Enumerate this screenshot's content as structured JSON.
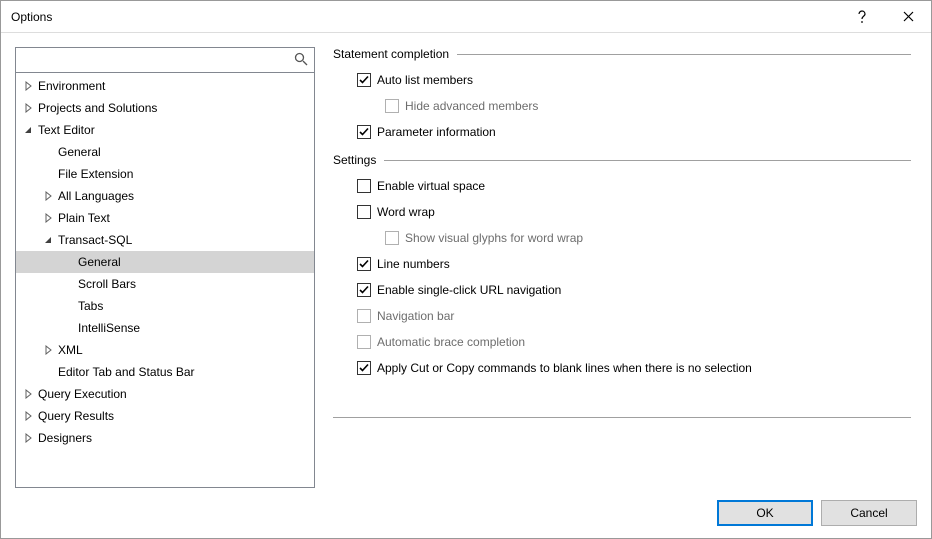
{
  "window": {
    "title": "Options"
  },
  "search": {
    "placeholder": ""
  },
  "tree": [
    {
      "label": "Environment",
      "indent": 1,
      "twisty": "closed"
    },
    {
      "label": "Projects and Solutions",
      "indent": 1,
      "twisty": "closed"
    },
    {
      "label": "Text Editor",
      "indent": 1,
      "twisty": "open"
    },
    {
      "label": "General",
      "indent": 2,
      "twisty": "none"
    },
    {
      "label": "File Extension",
      "indent": 2,
      "twisty": "none"
    },
    {
      "label": "All Languages",
      "indent": 2,
      "twisty": "closed"
    },
    {
      "label": "Plain Text",
      "indent": 2,
      "twisty": "closed"
    },
    {
      "label": "Transact-SQL",
      "indent": 2,
      "twisty": "open"
    },
    {
      "label": "General",
      "indent": 3,
      "twisty": "none",
      "selected": true
    },
    {
      "label": "Scroll Bars",
      "indent": 3,
      "twisty": "none"
    },
    {
      "label": "Tabs",
      "indent": 3,
      "twisty": "none"
    },
    {
      "label": "IntelliSense",
      "indent": 3,
      "twisty": "none"
    },
    {
      "label": "XML",
      "indent": 2,
      "twisty": "closed"
    },
    {
      "label": "Editor Tab and Status Bar",
      "indent": 2,
      "twisty": "none"
    },
    {
      "label": "Query Execution",
      "indent": 1,
      "twisty": "closed"
    },
    {
      "label": "Query Results",
      "indent": 1,
      "twisty": "closed"
    },
    {
      "label": "Designers",
      "indent": 1,
      "twisty": "closed"
    }
  ],
  "groups": [
    {
      "title": "Statement completion",
      "options": [
        {
          "label": "Auto list members",
          "checked": true,
          "disabled": false,
          "sub": false
        },
        {
          "label": "Hide advanced members",
          "checked": false,
          "disabled": true,
          "sub": true
        },
        {
          "label": "Parameter information",
          "checked": true,
          "disabled": false,
          "sub": false
        }
      ]
    },
    {
      "title": "Settings",
      "options": [
        {
          "label": "Enable virtual space",
          "checked": false,
          "disabled": false,
          "sub": false
        },
        {
          "label": "Word wrap",
          "checked": false,
          "disabled": false,
          "sub": false
        },
        {
          "label": "Show visual glyphs for word wrap",
          "checked": false,
          "disabled": true,
          "sub": true
        },
        {
          "label": "Line numbers",
          "checked": true,
          "disabled": false,
          "sub": false
        },
        {
          "label": "Enable single-click URL navigation",
          "checked": true,
          "disabled": false,
          "sub": false
        },
        {
          "label": "Navigation bar",
          "checked": false,
          "disabled": true,
          "sub": false
        },
        {
          "label": "Automatic brace completion",
          "checked": false,
          "disabled": true,
          "sub": false
        },
        {
          "label": "Apply Cut or Copy commands to blank lines when there is no selection",
          "checked": true,
          "disabled": false,
          "sub": false
        }
      ]
    }
  ],
  "buttons": {
    "ok": "OK",
    "cancel": "Cancel"
  }
}
